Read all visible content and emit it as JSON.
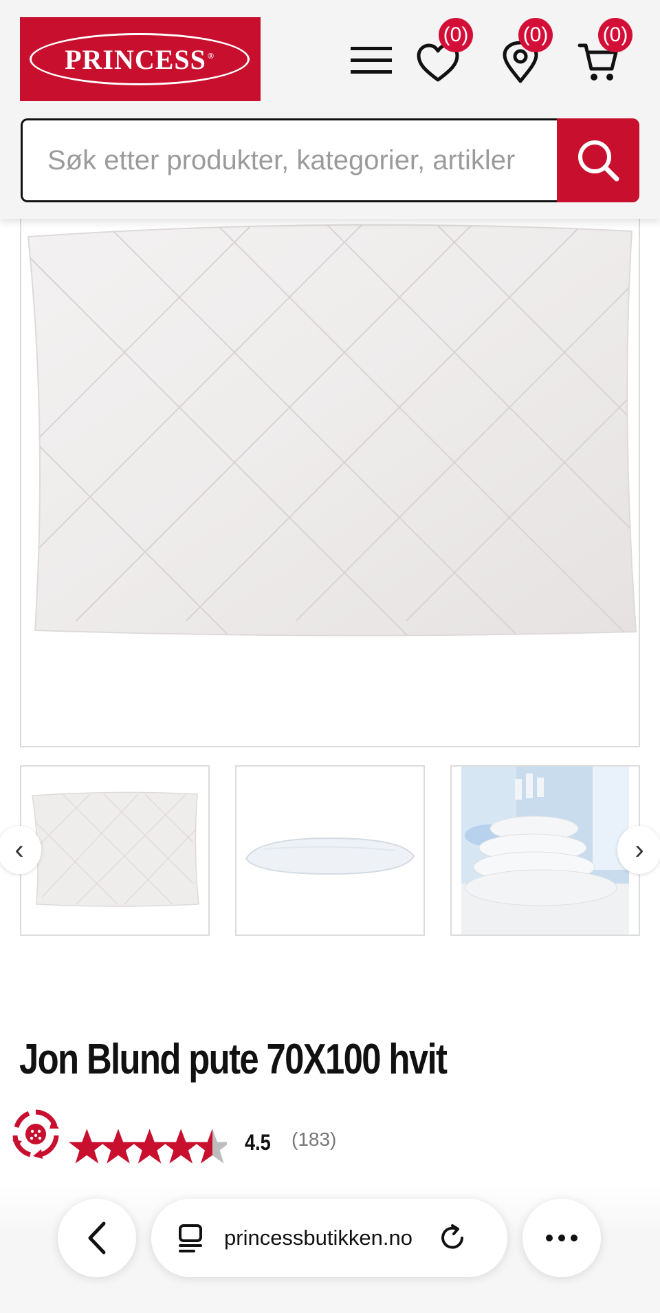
{
  "header": {
    "logo_text": "PRINCESS",
    "logo_reg": "®",
    "wishlist_count": "(0)",
    "stores_count": "(0)",
    "cart_count": "(0)"
  },
  "search": {
    "placeholder": "Søk etter produkter, kategorier, artikler"
  },
  "gallery": {
    "prev_label": "‹",
    "next_label": "›"
  },
  "product": {
    "title": "Jon Blund pute 70X100 hvit",
    "rating": "4.5",
    "review_count": "(183)",
    "stars_value": 4.5,
    "stars_max": 5
  },
  "browser": {
    "url": "princessbutikken.no"
  },
  "colors": {
    "brand_red": "#c8102e",
    "badge_red": "#d40f37"
  }
}
